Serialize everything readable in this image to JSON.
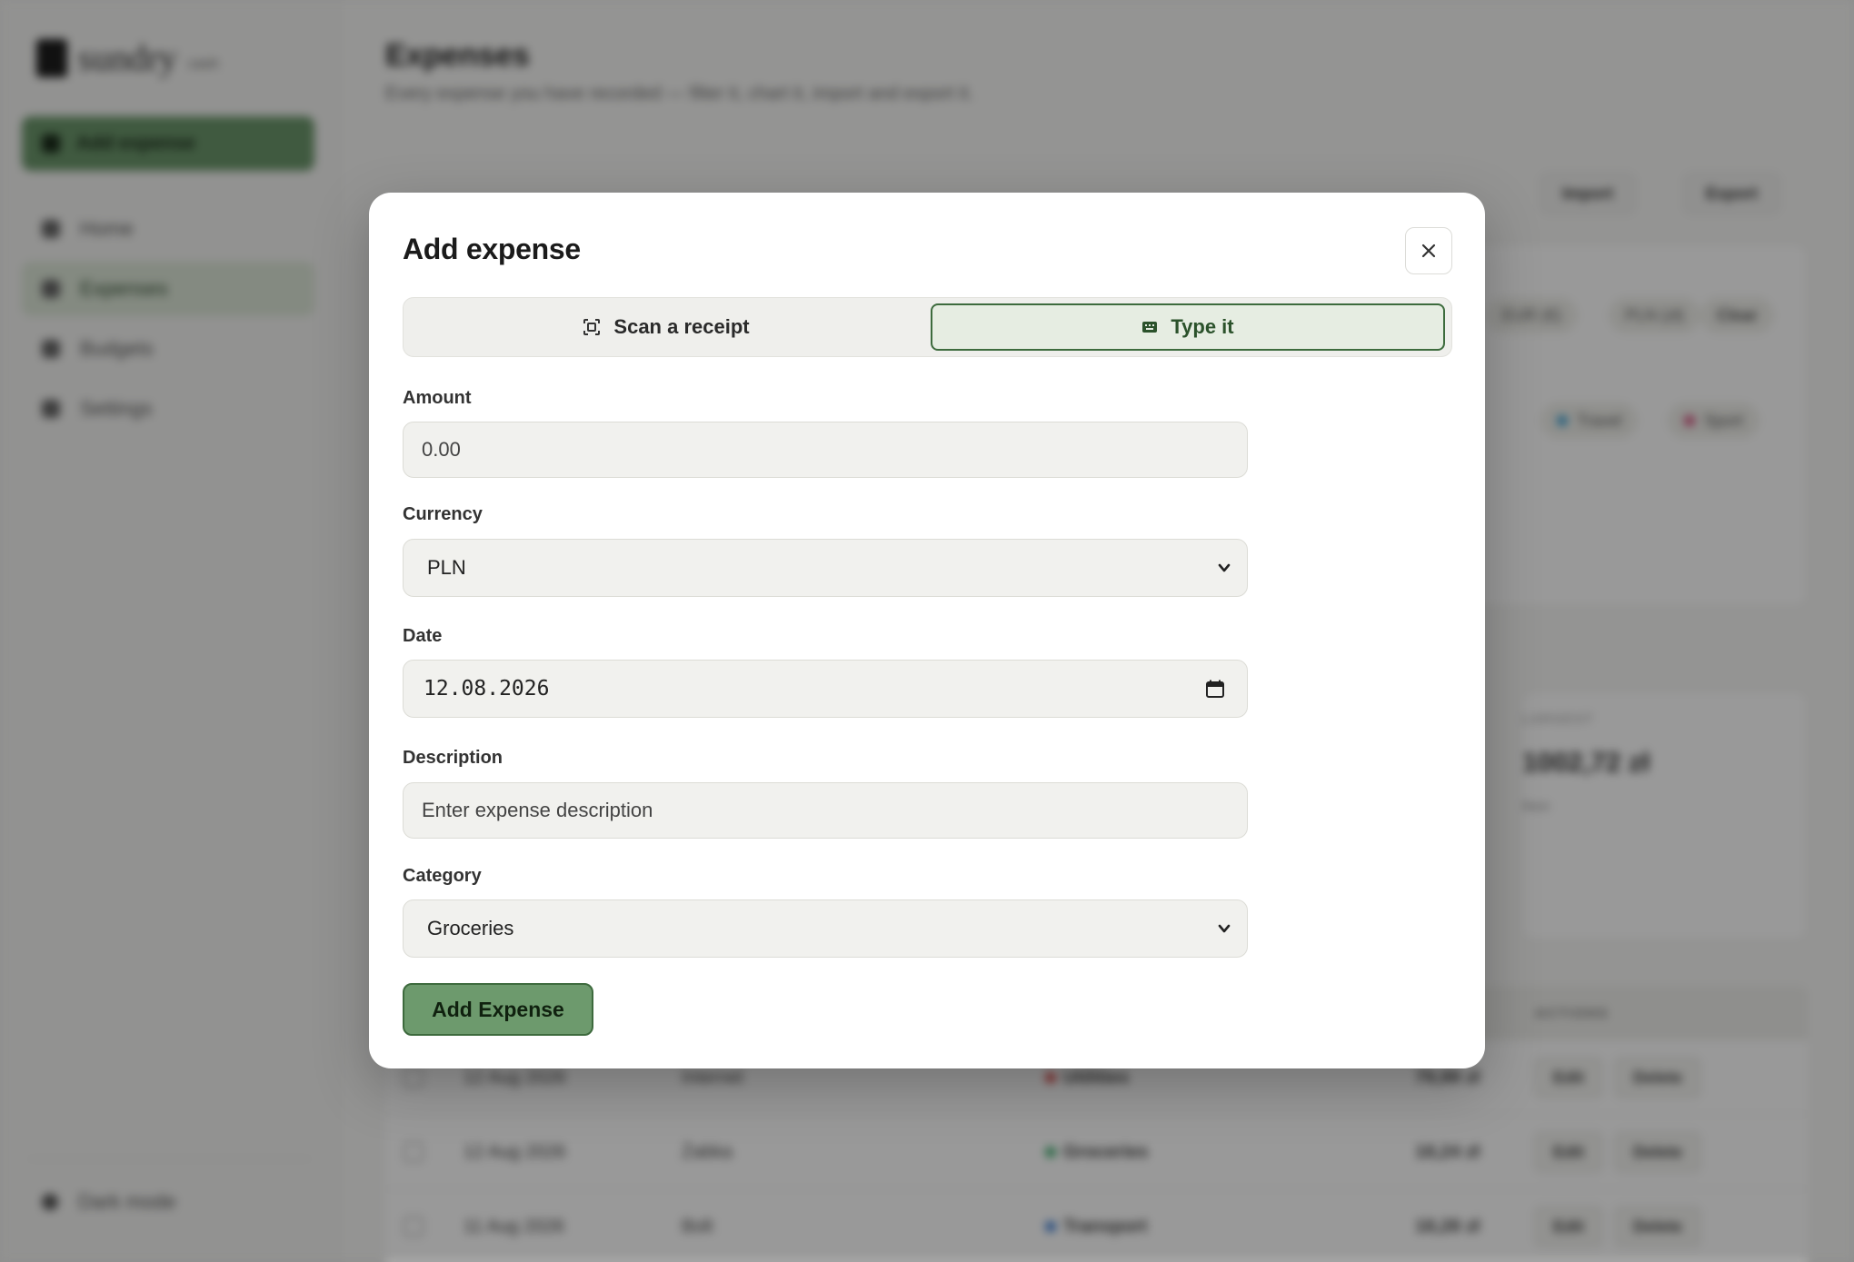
{
  "background": {
    "brand": {
      "name": "sundry",
      "suffix": "cash"
    },
    "sidebar": {
      "add_label": "Add expense",
      "items": [
        {
          "label": "Home",
          "active": false
        },
        {
          "label": "Expenses",
          "active": true
        },
        {
          "label": "Budgets",
          "active": false
        },
        {
          "label": "Settings",
          "active": false
        }
      ],
      "dark_mode_label": "Dark mode"
    },
    "page": {
      "title": "Expenses",
      "subtitle": "Every expense you have recorded — filter it, chart it, import and export it."
    },
    "toolbar": {
      "import_label": "Import",
      "export_label": "Export"
    },
    "filters": {
      "currency_chips": [
        "EUR (€)",
        "PLN (zł)"
      ],
      "clear_label": "Clear",
      "category_chips": [
        "Travel",
        "Sport"
      ]
    },
    "stat": {
      "label": "LARGEST",
      "value": "1002,72 zł",
      "note": "Rent"
    },
    "table": {
      "actions_header": "ACTIONS",
      "rows": [
        {
          "date": "12 Aug 2026",
          "description": "Internet",
          "category": "Utilities",
          "amount": "79,99 zł"
        },
        {
          "date": "12 Aug 2026",
          "description": "Żabka",
          "category": "Groceries",
          "amount": "18,24 zł"
        },
        {
          "date": "11 Aug 2026",
          "description": "Bolt",
          "category": "Transport",
          "amount": "18,28 zł"
        }
      ],
      "edit_label": "Edit",
      "delete_label": "Delete"
    }
  },
  "modal": {
    "title": "Add expense",
    "close_icon": "close-icon",
    "tabs": {
      "scan_label": "Scan a receipt",
      "type_label": "Type it",
      "active": "Type it"
    },
    "amount": {
      "label": "Amount",
      "placeholder": "0.00"
    },
    "currency": {
      "label": "Currency",
      "value": "PLN"
    },
    "date": {
      "label": "Date",
      "value": "12.08.2026"
    },
    "description": {
      "label": "Description",
      "placeholder": "Enter expense description"
    },
    "category": {
      "label": "Category",
      "value": "Groceries"
    },
    "submit_label": "Add Expense"
  },
  "colors": {
    "accent": "#6d9a6d",
    "accent_dark": "#3d6b3d",
    "overlay": "#8f8f8e"
  }
}
